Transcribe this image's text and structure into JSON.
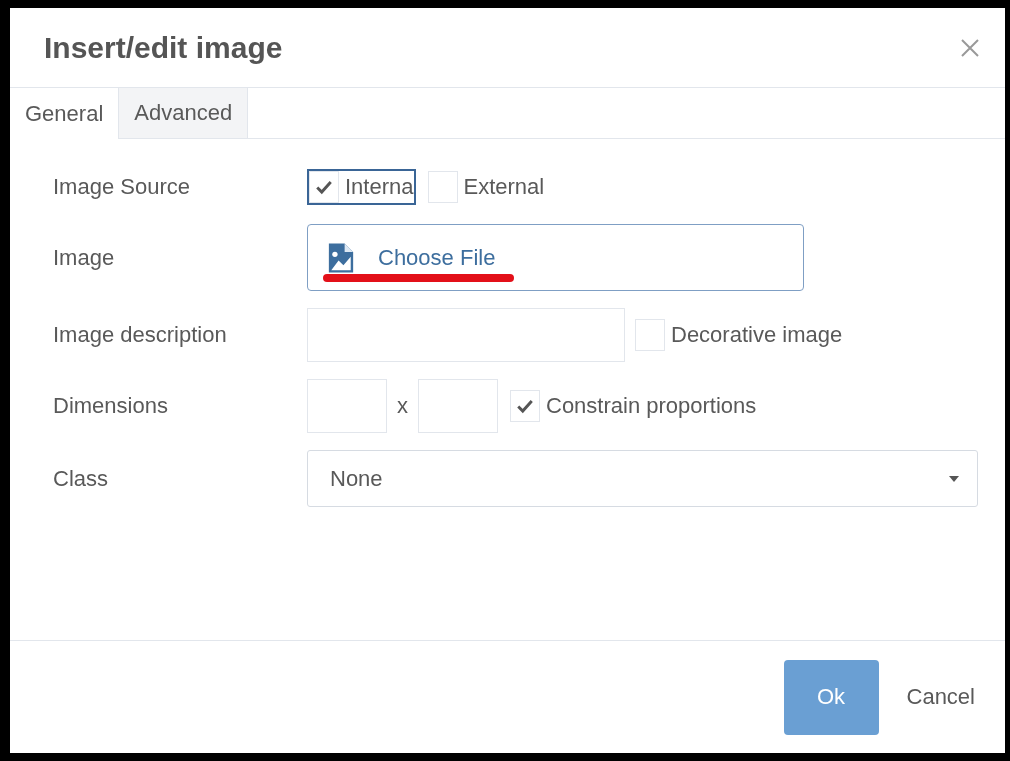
{
  "dialog": {
    "title": "Insert/edit image"
  },
  "tabs": [
    {
      "label": "General",
      "selected": true
    },
    {
      "label": "Advanced",
      "selected": false
    }
  ],
  "form": [
    {
      "kind": "checkboxes",
      "label": "Image Source",
      "options": [
        {
          "label": "Interna",
          "checked": true,
          "focused": true
        },
        {
          "label": "External",
          "checked": false,
          "focused": false
        }
      ]
    },
    {
      "kind": "file",
      "label": "Image",
      "button": "Choose File",
      "underlined": true
    },
    {
      "kind": "text-check",
      "label": "Image description",
      "option": {
        "label": "Decorative image",
        "checked": false
      }
    },
    {
      "kind": "dimensions",
      "label": "Dimensions",
      "separator": "x",
      "option": {
        "label": "Constrain proportions",
        "checked": true
      }
    },
    {
      "kind": "select",
      "label": "Class",
      "value": "None"
    }
  ],
  "buttons": [
    {
      "label": "Ok",
      "primary": true
    },
    {
      "label": "Cancel",
      "primary": false
    }
  ]
}
